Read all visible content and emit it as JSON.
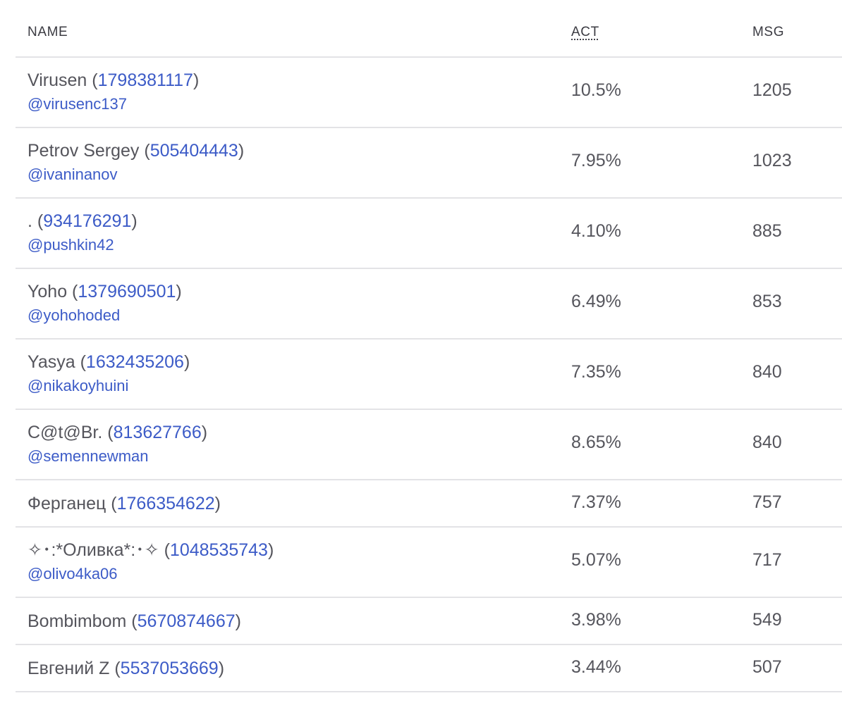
{
  "table": {
    "headers": {
      "name": "NAME",
      "act": "ACT",
      "msg": "MSG"
    },
    "rows": [
      {
        "name": "Virusen",
        "id": "1798381117",
        "handle": "@virusenc137",
        "act": "10.5%",
        "msg": "1205"
      },
      {
        "name": "Petrov Sergey",
        "id": "505404443",
        "handle": "@ivaninanov",
        "act": "7.95%",
        "msg": "1023"
      },
      {
        "name": ".",
        "id": "934176291",
        "handle": "@pushkin42",
        "act": "4.10%",
        "msg": "885"
      },
      {
        "name": "Yoho",
        "id": "1379690501",
        "handle": "@yohohoded",
        "act": "6.49%",
        "msg": "853"
      },
      {
        "name": "Yasya",
        "id": "1632435206",
        "handle": "@nikakoyhuini",
        "act": "7.35%",
        "msg": "840"
      },
      {
        "name": "C@t@Br.",
        "id": "813627766",
        "handle": "@semennewman",
        "act": "8.65%",
        "msg": "840"
      },
      {
        "name": "Ферганец",
        "id": "1766354622",
        "handle": "",
        "act": "7.37%",
        "msg": "757"
      },
      {
        "name": "✧･:*Оливка*:･✧",
        "id": "1048535743",
        "handle": "@olivo4ka06",
        "act": "5.07%",
        "msg": "717"
      },
      {
        "name": "Bombimbom",
        "id": "5670874667",
        "handle": "",
        "act": "3.98%",
        "msg": "549"
      },
      {
        "name": "Евгений Z",
        "id": "5537053669",
        "handle": "",
        "act": "3.44%",
        "msg": "507"
      }
    ]
  },
  "colors": {
    "text": "#55555c",
    "link": "#3c5bc7",
    "header": "#3b3b42",
    "divider": "#e3e3e6"
  }
}
